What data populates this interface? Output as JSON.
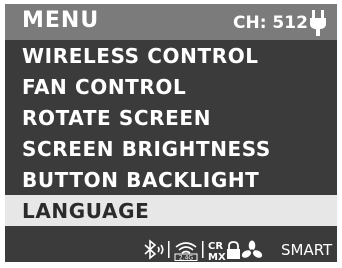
{
  "header": {
    "title": "MENU",
    "channel_label": "CH: 512",
    "power_icon": "plug-icon"
  },
  "menu": {
    "items": [
      {
        "label": "WIRELESS CONTROL",
        "selected": false
      },
      {
        "label": "FAN CONTROL",
        "selected": false
      },
      {
        "label": "ROTATE SCREEN",
        "selected": false
      },
      {
        "label": "SCREEN BRIGHTNESS",
        "selected": false
      },
      {
        "label": "BUTTON BACKLIGHT",
        "selected": false
      },
      {
        "label": "LANGUAGE",
        "selected": true
      }
    ]
  },
  "status_bar": {
    "icons": [
      "bluetooth-icon",
      "wifi-2.4g-icon",
      "crmx-icon",
      "lock-icon",
      "fan-icon"
    ],
    "wifi_band": "2.4G",
    "crmx_top": "CR",
    "crmx_bottom": "MX",
    "mode_label": "SMART"
  },
  "colors": {
    "background": "#3b3b3b",
    "header": "#7b7b7b",
    "selected_bg": "#e7e7e7",
    "text": "#ffffff"
  }
}
